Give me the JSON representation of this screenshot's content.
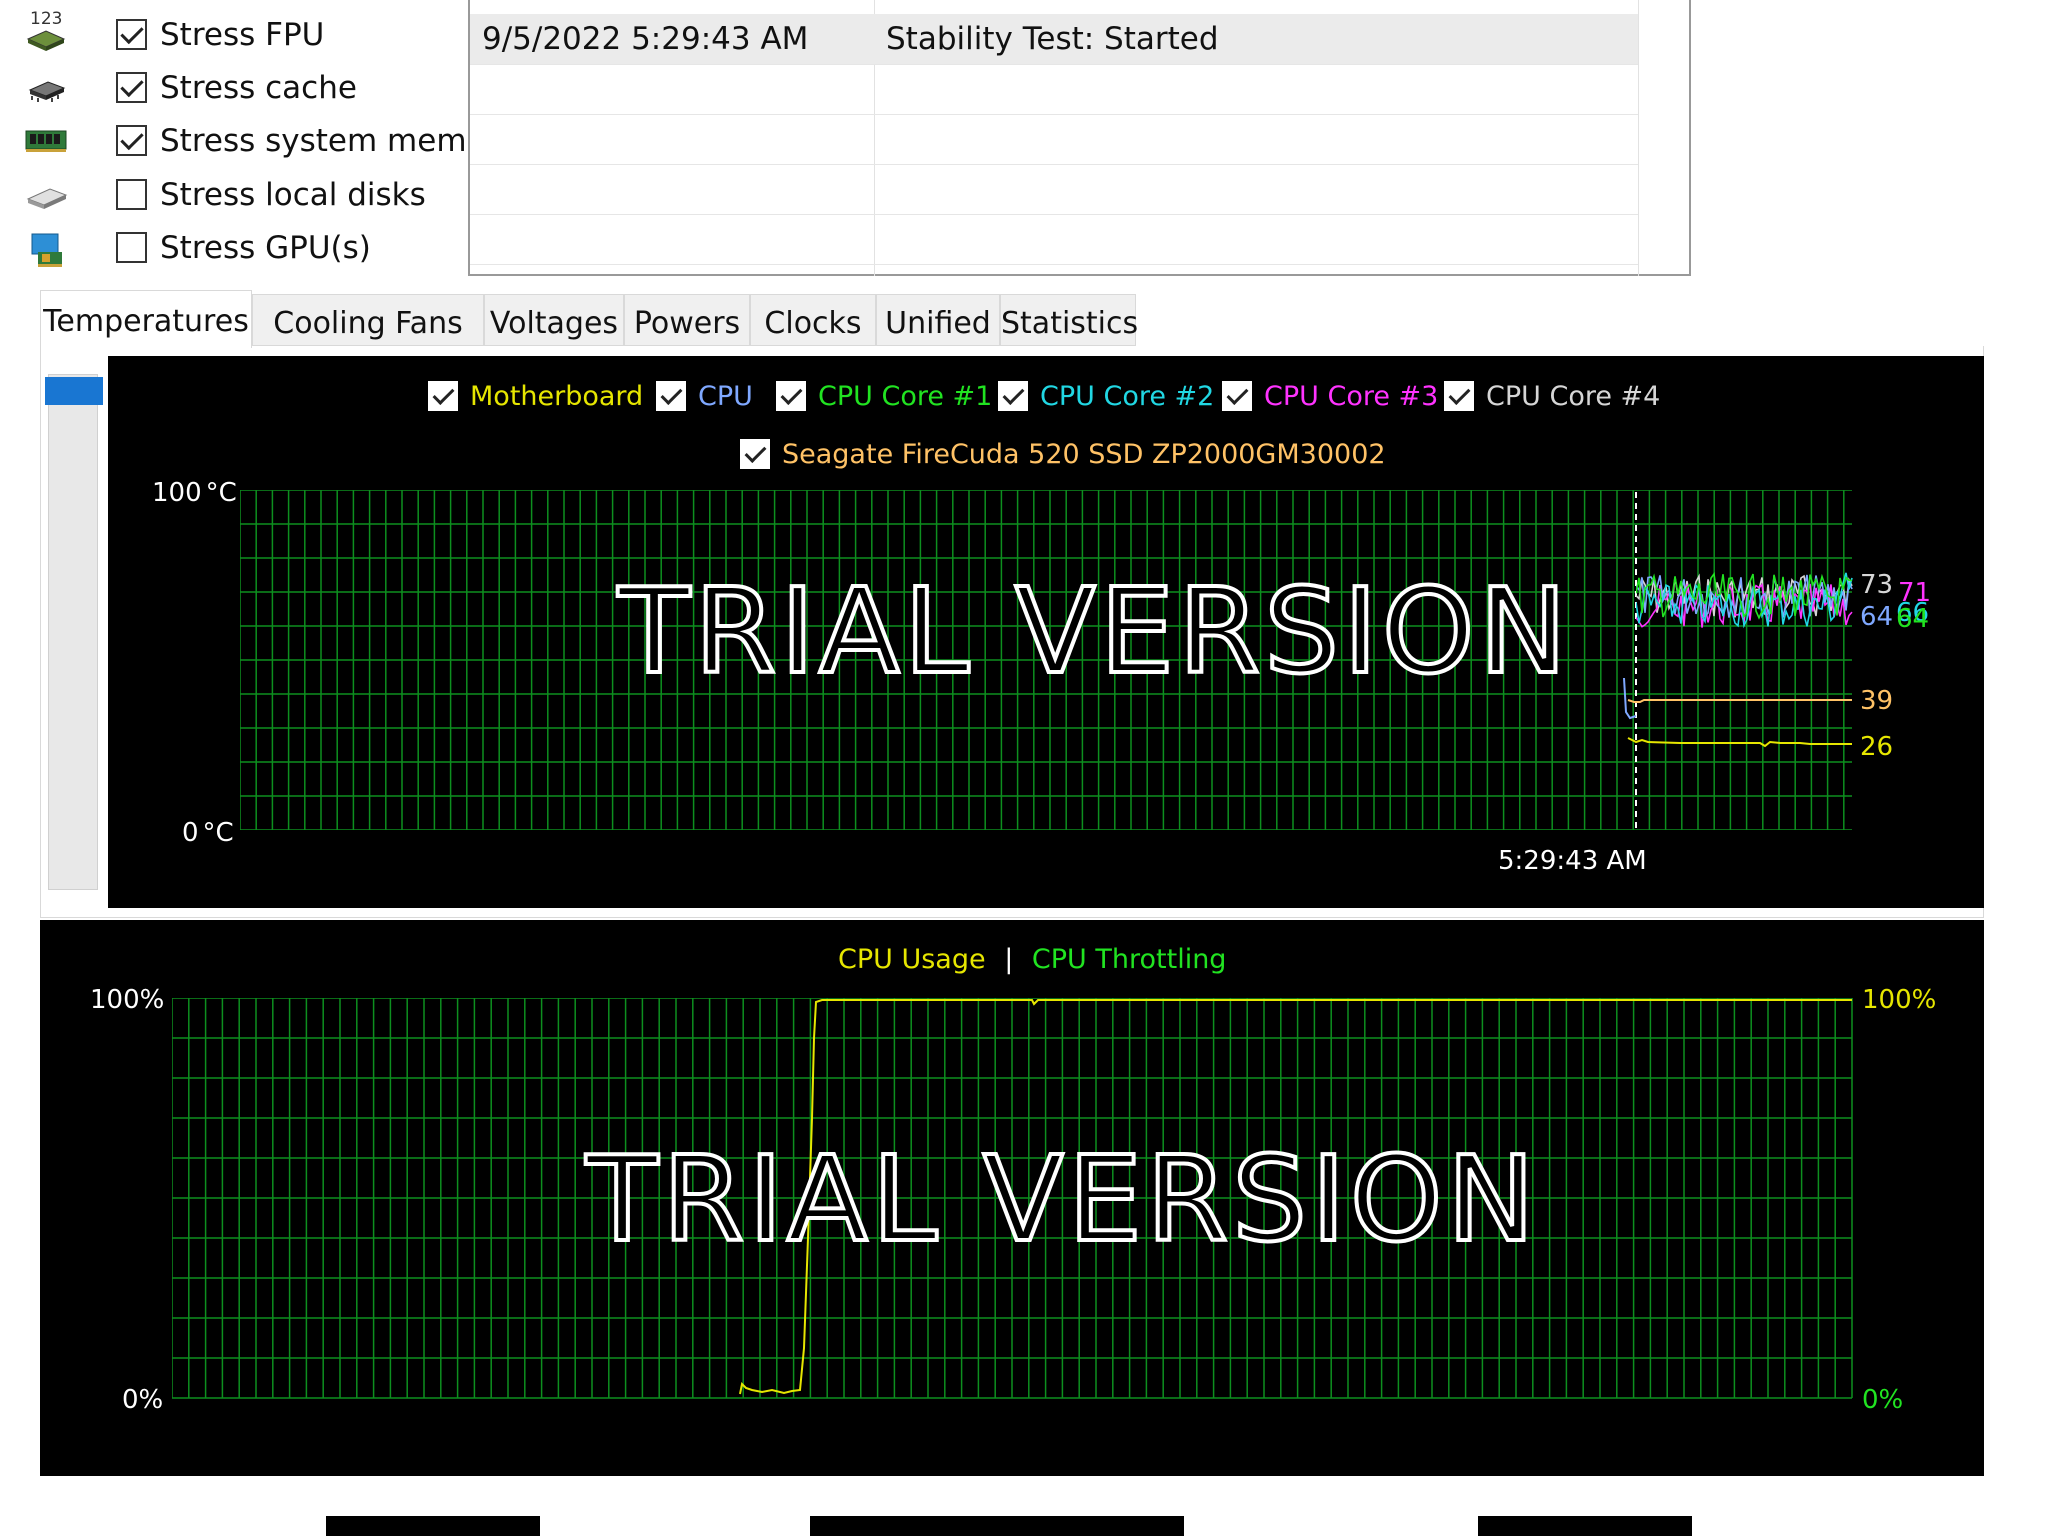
{
  "stress_options": [
    {
      "label": "Stress FPU",
      "checked": true,
      "icon": "fpu-icon"
    },
    {
      "label": "Stress cache",
      "checked": true,
      "icon": "cache-chip-icon"
    },
    {
      "label": "Stress system memory",
      "checked": true,
      "icon": "memory-module-icon"
    },
    {
      "label": "Stress local disks",
      "checked": false,
      "icon": "disk-drive-icon"
    },
    {
      "label": "Stress GPU(s)",
      "checked": false,
      "icon": "gpu-card-icon"
    }
  ],
  "fpu_icon_text": "123",
  "log": {
    "rows": [
      {
        "datetime": "9/5/2022 5:29:43 AM",
        "status": "Stability Test: Started"
      }
    ]
  },
  "tabs": [
    "Temperatures",
    "Cooling Fans",
    "Voltages",
    "Powers",
    "Clocks",
    "Unified",
    "Statistics"
  ],
  "active_tab": "Temperatures",
  "temp_chart": {
    "legend": [
      {
        "label": "Motherboard",
        "color": "#e6e600"
      },
      {
        "label": "CPU",
        "color": "#7fa8ff"
      },
      {
        "label": "CPU Core #1",
        "color": "#21e321"
      },
      {
        "label": "CPU Core #2",
        "color": "#21d7e3"
      },
      {
        "label": "CPU Core #3",
        "color": "#ff33ff"
      },
      {
        "label": "CPU Core #4",
        "color": "#d6d6d6"
      },
      {
        "label": "Seagate FireCuda 520 SSD ZP2000GM30002",
        "color": "#ffc266"
      }
    ],
    "y_top": "100",
    "y_bottom": "0",
    "unit": "°C",
    "time_label": "5:29:43 AM",
    "watermark": "TRIAL VERSION",
    "value_labels": [
      {
        "text": "73",
        "color": "#d6d6d6"
      },
      {
        "text": "71",
        "color": "#ff33ff"
      },
      {
        "text": "64",
        "color": "#7fa8ff"
      },
      {
        "text": "66",
        "color": "#21d7e3"
      },
      {
        "text": "64",
        "color": "#21e321"
      },
      {
        "text": "39",
        "color": "#ffc266"
      },
      {
        "text": "26",
        "color": "#e6e600"
      }
    ]
  },
  "cpu_chart": {
    "legend_usage": "CPU Usage",
    "separator": "|",
    "legend_throttling": "CPU Throttling",
    "usage_color": "#e6e600",
    "throttle_color": "#21e321",
    "left_top": "100%",
    "left_bottom": "0%",
    "right_top": "100%",
    "right_bottom": "0%",
    "watermark": "TRIAL VERSION"
  }
}
